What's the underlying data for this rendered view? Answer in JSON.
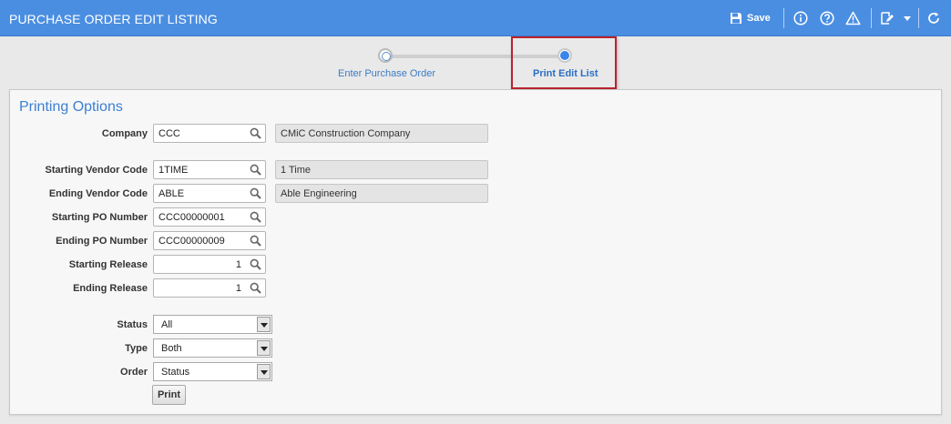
{
  "header": {
    "title": "PURCHASE ORDER EDIT LISTING",
    "save_label": "Save",
    "icons": [
      "save-icon",
      "info-icon",
      "help-icon",
      "warning-icon",
      "edit-note-icon",
      "chevron-down-icon",
      "refresh-icon"
    ]
  },
  "stepper": {
    "steps": [
      {
        "label": "Enter Purchase Order",
        "state": "completed"
      },
      {
        "label": "Print Edit List",
        "state": "active"
      }
    ]
  },
  "panel": {
    "title": "Printing Options"
  },
  "form": {
    "company": {
      "label": "Company",
      "value": "CCC",
      "description": "CMiC Construction Company"
    },
    "start_vendor": {
      "label": "Starting Vendor Code",
      "value": "1TIME",
      "description": "1 Time"
    },
    "end_vendor": {
      "label": "Ending Vendor Code",
      "value": "ABLE",
      "description": "Able Engineering"
    },
    "start_po": {
      "label": "Starting PO Number",
      "value": "CCC00000001"
    },
    "end_po": {
      "label": "Ending PO Number",
      "value": "CCC00000009"
    },
    "start_release": {
      "label": "Starting Release",
      "value": "1"
    },
    "end_release": {
      "label": "Ending Release",
      "value": "1"
    },
    "status": {
      "label": "Status",
      "selected": "All"
    },
    "type": {
      "label": "Type",
      "selected": "Both"
    },
    "order": {
      "label": "Order",
      "selected": "Status"
    },
    "print_label": "Print"
  },
  "colors": {
    "header_bg": "#4a8ee2",
    "accent": "#3c80d0",
    "highlight_border": "#b8232e"
  }
}
